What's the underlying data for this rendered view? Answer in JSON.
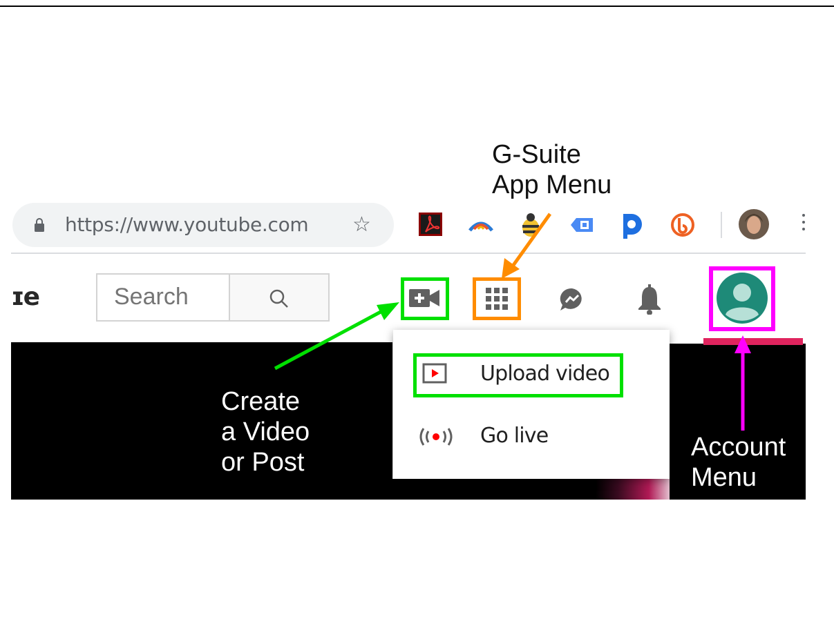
{
  "browser": {
    "url": "https://www.youtube.com",
    "extensions": [
      "adobe-acrobat-icon",
      "arc-extension-icon",
      "bee-extension-icon",
      "tag-extension-icon",
      "blue-d-extension-icon",
      "bitly-icon"
    ],
    "profile": "profile-avatar"
  },
  "youtube": {
    "logo_fragment": "ɪe",
    "search_placeholder": "Search",
    "search_icon": "search-icon",
    "header_icons": [
      "create-video-icon",
      "apps-grid-icon",
      "messages-icon",
      "notifications-bell-icon",
      "account-avatar-icon"
    ]
  },
  "dropdown": {
    "items": [
      {
        "label": "Upload video",
        "icon": "upload-play-icon"
      },
      {
        "label": "Go live",
        "icon": "live-broadcast-icon"
      }
    ]
  },
  "annotations": {
    "gsuite": {
      "line1": "G-Suite",
      "line2": "App Menu",
      "color": "#ff8c00"
    },
    "create": {
      "line1": "Create",
      "line2": "a Video",
      "line3": "or Post",
      "color": "#00e000"
    },
    "account": {
      "line1": "Account",
      "line2": "Menu",
      "color": "#ff00ff"
    }
  },
  "colors": {
    "youtube_red": "#ff0000",
    "avatar_teal": "#1e8a78",
    "icon_grey": "#606060"
  }
}
